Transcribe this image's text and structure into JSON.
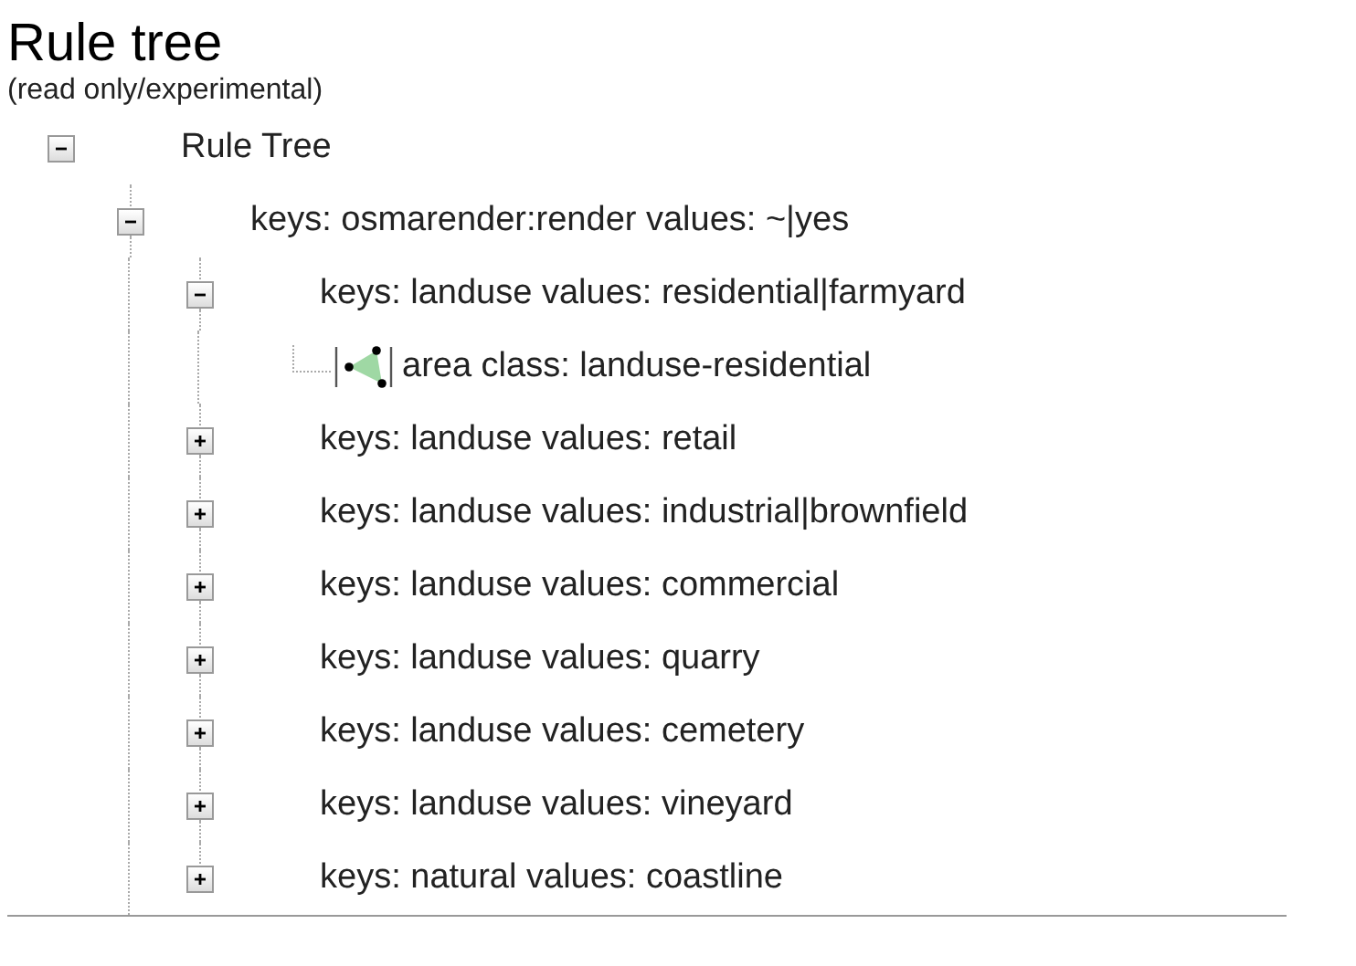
{
  "title": "Rule tree",
  "subtitle": "(read only/experimental)",
  "tree": [
    {
      "kind": "rule",
      "label": "Rule Tree",
      "expanded": true,
      "children": [
        {
          "kind": "rule",
          "label": "keys: osmarender:render values: ~|yes",
          "expanded": true,
          "children": [
            {
              "kind": "rule",
              "label": "keys: landuse values: residential|farmyard",
              "expanded": true,
              "children": [
                {
                  "kind": "area",
                  "label": "area class: landuse-residential"
                }
              ]
            },
            {
              "kind": "rule",
              "label": "keys: landuse values: retail",
              "expanded": false
            },
            {
              "kind": "rule",
              "label": "keys: landuse values: industrial|brownfield",
              "expanded": false
            },
            {
              "kind": "rule",
              "label": "keys: landuse values: commercial",
              "expanded": false
            },
            {
              "kind": "rule",
              "label": "keys: landuse values: quarry",
              "expanded": false
            },
            {
              "kind": "rule",
              "label": "keys: landuse values: cemetery",
              "expanded": false
            },
            {
              "kind": "rule",
              "label": "keys: landuse values: vineyard",
              "expanded": false
            },
            {
              "kind": "rule",
              "label": "keys: natural values: coastline",
              "expanded": false
            }
          ]
        }
      ]
    }
  ]
}
